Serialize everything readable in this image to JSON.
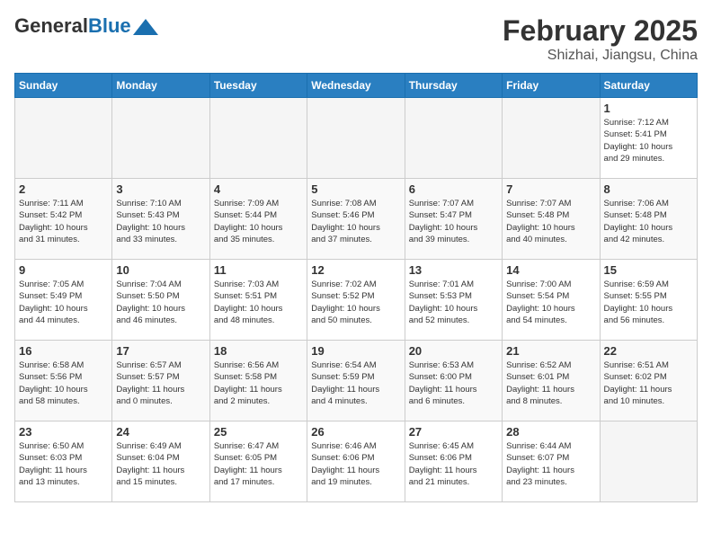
{
  "header": {
    "logo_general": "General",
    "logo_blue": "Blue",
    "month_title": "February 2025",
    "location": "Shizhai, Jiangsu, China"
  },
  "weekdays": [
    "Sunday",
    "Monday",
    "Tuesday",
    "Wednesday",
    "Thursday",
    "Friday",
    "Saturday"
  ],
  "weeks": [
    [
      {
        "day": "",
        "info": ""
      },
      {
        "day": "",
        "info": ""
      },
      {
        "day": "",
        "info": ""
      },
      {
        "day": "",
        "info": ""
      },
      {
        "day": "",
        "info": ""
      },
      {
        "day": "",
        "info": ""
      },
      {
        "day": "1",
        "info": "Sunrise: 7:12 AM\nSunset: 5:41 PM\nDaylight: 10 hours\nand 29 minutes."
      }
    ],
    [
      {
        "day": "2",
        "info": "Sunrise: 7:11 AM\nSunset: 5:42 PM\nDaylight: 10 hours\nand 31 minutes."
      },
      {
        "day": "3",
        "info": "Sunrise: 7:10 AM\nSunset: 5:43 PM\nDaylight: 10 hours\nand 33 minutes."
      },
      {
        "day": "4",
        "info": "Sunrise: 7:09 AM\nSunset: 5:44 PM\nDaylight: 10 hours\nand 35 minutes."
      },
      {
        "day": "5",
        "info": "Sunrise: 7:08 AM\nSunset: 5:46 PM\nDaylight: 10 hours\nand 37 minutes."
      },
      {
        "day": "6",
        "info": "Sunrise: 7:07 AM\nSunset: 5:47 PM\nDaylight: 10 hours\nand 39 minutes."
      },
      {
        "day": "7",
        "info": "Sunrise: 7:07 AM\nSunset: 5:48 PM\nDaylight: 10 hours\nand 40 minutes."
      },
      {
        "day": "8",
        "info": "Sunrise: 7:06 AM\nSunset: 5:48 PM\nDaylight: 10 hours\nand 42 minutes."
      }
    ],
    [
      {
        "day": "9",
        "info": "Sunrise: 7:05 AM\nSunset: 5:49 PM\nDaylight: 10 hours\nand 44 minutes."
      },
      {
        "day": "10",
        "info": "Sunrise: 7:04 AM\nSunset: 5:50 PM\nDaylight: 10 hours\nand 46 minutes."
      },
      {
        "day": "11",
        "info": "Sunrise: 7:03 AM\nSunset: 5:51 PM\nDaylight: 10 hours\nand 48 minutes."
      },
      {
        "day": "12",
        "info": "Sunrise: 7:02 AM\nSunset: 5:52 PM\nDaylight: 10 hours\nand 50 minutes."
      },
      {
        "day": "13",
        "info": "Sunrise: 7:01 AM\nSunset: 5:53 PM\nDaylight: 10 hours\nand 52 minutes."
      },
      {
        "day": "14",
        "info": "Sunrise: 7:00 AM\nSunset: 5:54 PM\nDaylight: 10 hours\nand 54 minutes."
      },
      {
        "day": "15",
        "info": "Sunrise: 6:59 AM\nSunset: 5:55 PM\nDaylight: 10 hours\nand 56 minutes."
      }
    ],
    [
      {
        "day": "16",
        "info": "Sunrise: 6:58 AM\nSunset: 5:56 PM\nDaylight: 10 hours\nand 58 minutes."
      },
      {
        "day": "17",
        "info": "Sunrise: 6:57 AM\nSunset: 5:57 PM\nDaylight: 11 hours\nand 0 minutes."
      },
      {
        "day": "18",
        "info": "Sunrise: 6:56 AM\nSunset: 5:58 PM\nDaylight: 11 hours\nand 2 minutes."
      },
      {
        "day": "19",
        "info": "Sunrise: 6:54 AM\nSunset: 5:59 PM\nDaylight: 11 hours\nand 4 minutes."
      },
      {
        "day": "20",
        "info": "Sunrise: 6:53 AM\nSunset: 6:00 PM\nDaylight: 11 hours\nand 6 minutes."
      },
      {
        "day": "21",
        "info": "Sunrise: 6:52 AM\nSunset: 6:01 PM\nDaylight: 11 hours\nand 8 minutes."
      },
      {
        "day": "22",
        "info": "Sunrise: 6:51 AM\nSunset: 6:02 PM\nDaylight: 11 hours\nand 10 minutes."
      }
    ],
    [
      {
        "day": "23",
        "info": "Sunrise: 6:50 AM\nSunset: 6:03 PM\nDaylight: 11 hours\nand 13 minutes."
      },
      {
        "day": "24",
        "info": "Sunrise: 6:49 AM\nSunset: 6:04 PM\nDaylight: 11 hours\nand 15 minutes."
      },
      {
        "day": "25",
        "info": "Sunrise: 6:47 AM\nSunset: 6:05 PM\nDaylight: 11 hours\nand 17 minutes."
      },
      {
        "day": "26",
        "info": "Sunrise: 6:46 AM\nSunset: 6:06 PM\nDaylight: 11 hours\nand 19 minutes."
      },
      {
        "day": "27",
        "info": "Sunrise: 6:45 AM\nSunset: 6:06 PM\nDaylight: 11 hours\nand 21 minutes."
      },
      {
        "day": "28",
        "info": "Sunrise: 6:44 AM\nSunset: 6:07 PM\nDaylight: 11 hours\nand 23 minutes."
      },
      {
        "day": "",
        "info": ""
      }
    ]
  ]
}
